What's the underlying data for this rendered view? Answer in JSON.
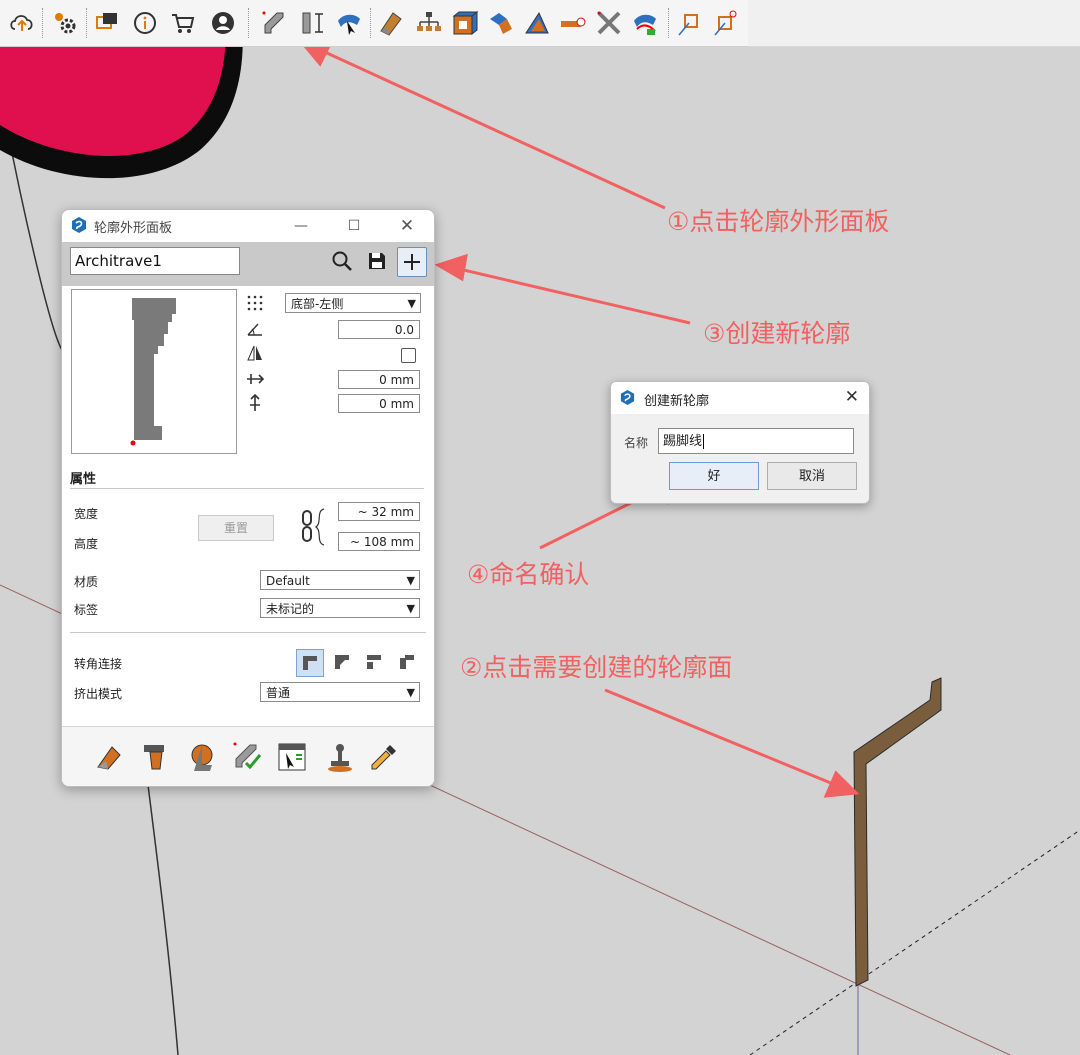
{
  "toolbar": {
    "icons": [
      "cloud-upload-icon",
      "settings-icon",
      "chat-icon",
      "info-icon",
      "cart-icon",
      "account-icon",
      "profile-path-icon",
      "dimension-profile-icon",
      "select-path-icon",
      "eraser-icon",
      "hierarchy-icon",
      "box-icon",
      "fold-icon",
      "bevel-icon",
      "add-tag-icon",
      "cross-icon",
      "loft-icon",
      "corner-icon",
      "frame-icon"
    ]
  },
  "profile_panel": {
    "title": "轮廓外形面板",
    "profile_name": "Architrave1",
    "anchor_select": "底部-左侧",
    "rotation_value": "0.0",
    "offset_x": "0 mm",
    "offset_y": "0 mm",
    "attributes_title": "属性",
    "width_label": "宽度",
    "height_label": "高度",
    "reset_label": "重置",
    "width_value": "~ 32 mm",
    "height_value": "~ 108 mm",
    "material_label": "材质",
    "material_value": "Default",
    "tag_label": "标签",
    "tag_value": "未标记的",
    "corner_label": "转角连接",
    "extrude_label": "挤出模式",
    "extrude_value": "普通"
  },
  "new_profile_dialog": {
    "title": "创建新轮廓",
    "name_label": "名称",
    "name_value": "踢脚线",
    "ok_label": "好",
    "cancel_label": "取消"
  },
  "annotations": {
    "step1": "①点击轮廓外形面板",
    "step2": "②点击需要创建的轮廓面",
    "step3": "③创建新轮廓",
    "step4": "④命名确认"
  },
  "colors": {
    "annotation": "#f26161",
    "model_red": "#e0104f",
    "profile_wood": "#7a5d3c",
    "canvas": "#d3d3d3"
  }
}
